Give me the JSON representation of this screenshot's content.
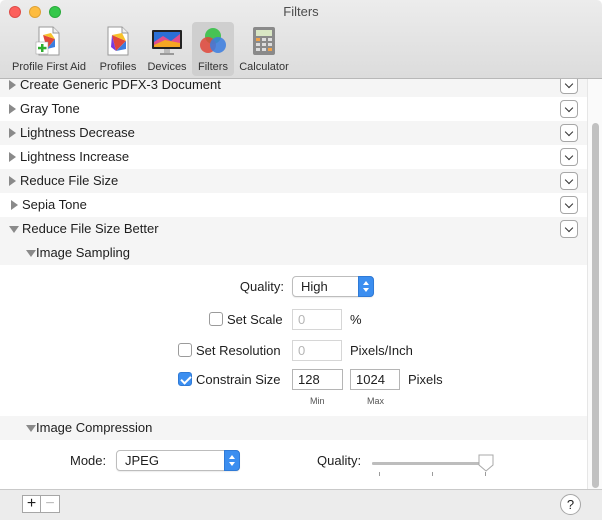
{
  "window": {
    "title": "Filters"
  },
  "toolbar": [
    {
      "label": "Profile First Aid",
      "icon": "profile-first-aid-icon"
    },
    {
      "label": "Profiles",
      "icon": "profiles-icon"
    },
    {
      "label": "Devices",
      "icon": "devices-icon"
    },
    {
      "label": "Filters",
      "icon": "filters-icon",
      "selected": true
    },
    {
      "label": "Calculator",
      "icon": "calculator-icon"
    }
  ],
  "filters": [
    "Create Generic PDFX-3 Document",
    "Gray Tone",
    "Lightness Decrease",
    "Lightness Increase",
    "Reduce File Size",
    "Sepia Tone",
    "Reduce File Size Better"
  ],
  "expanded_filter": {
    "image_sampling": {
      "title": "Image Sampling",
      "quality_label": "Quality:",
      "quality_value": "High",
      "set_scale": {
        "label": "Set Scale",
        "checked": false,
        "value": "0",
        "unit": "%"
      },
      "set_resolution": {
        "label": "Set Resolution",
        "checked": false,
        "value": "0",
        "unit": "Pixels/Inch"
      },
      "constrain_size": {
        "label": "Constrain Size",
        "checked": true,
        "min_value": "128",
        "max_value": "1024",
        "unit": "Pixels",
        "min_label": "Min",
        "max_label": "Max"
      }
    },
    "image_compression": {
      "title": "Image Compression",
      "mode_label": "Mode:",
      "mode_value": "JPEG",
      "quality_label": "Quality:",
      "quality_level": 0.98
    }
  },
  "bottom": {
    "add": "+",
    "remove": "−",
    "help": "?"
  },
  "colors": {
    "accent": "#3b8ef0",
    "close": "#fc605c",
    "minimize": "#fdbc40",
    "zoom": "#34c84a"
  }
}
